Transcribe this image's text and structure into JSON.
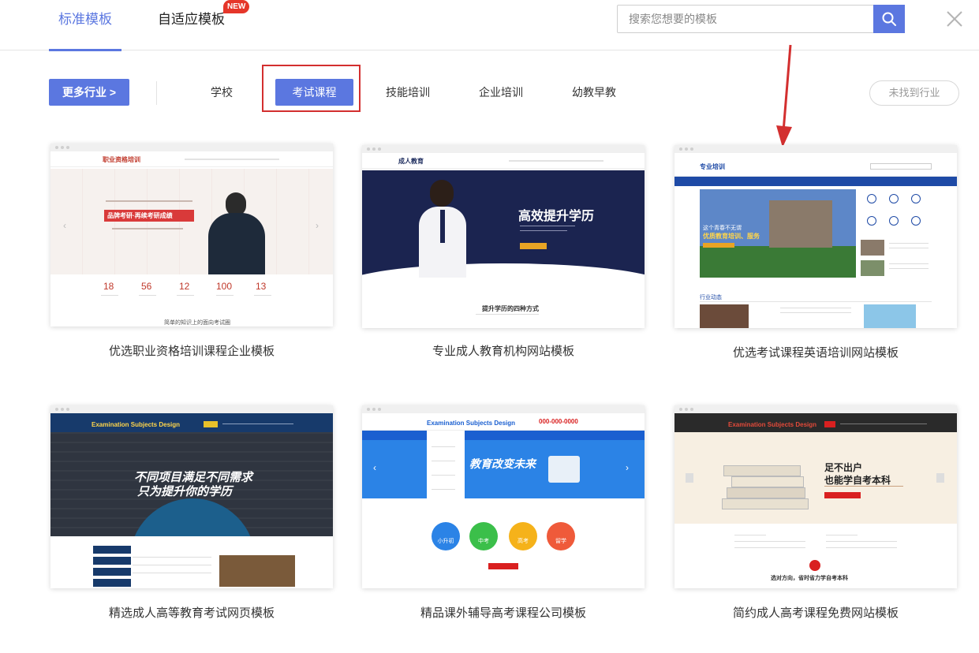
{
  "tabs": {
    "standard": "标准模板",
    "adaptive": "自适应模板",
    "new_badge": "NEW"
  },
  "search": {
    "placeholder": "搜索您想要的模板"
  },
  "filters": {
    "more_label": "更多行业 >",
    "categories": [
      "学校",
      "考试课程",
      "技能培训",
      "企业培训",
      "幼教早教"
    ],
    "active": "考试课程",
    "not_found_label": "未找到行业"
  },
  "colors": {
    "accent": "#5b77e0",
    "highlight_frame": "#d32f2f",
    "badge": "#e5362a"
  },
  "templates": [
    {
      "title": "优选职业资格培训课程企业模板",
      "preview": {
        "logo": "职业资格培训",
        "slogan": "品牌考研·再续考研成绩",
        "stats": [
          "18",
          "56",
          "12",
          "100",
          "13"
        ],
        "footer_text": "简单的知识上的面向考试圈"
      }
    },
    {
      "title": "专业成人教育机构网站模板",
      "preview": {
        "logo": "成人教育",
        "headline": "高效提升学历",
        "section_title": "提升学历的四种方式"
      }
    },
    {
      "title": "优选考试课程英语培训网站模板",
      "preview": {
        "logo": "专业培训",
        "banner_line1": "这个青春不无谓",
        "banner_line2": "优质教育培训、服务",
        "section_title": "行业动态"
      }
    },
    {
      "title": "精选成人高等教育考试网页模板",
      "preview": {
        "logo": "Examination Subjects Design",
        "line1": "不同项目满足不同需求",
        "line2": "只为提升你的学历"
      }
    },
    {
      "title": "精品课外辅导高考课程公司模板",
      "preview": {
        "logo": "Examination Subjects Design",
        "phone": "000-000-0000",
        "headline": "教育改变未来",
        "circles": [
          "小升初",
          "中考",
          "高考",
          "留学"
        ]
      }
    },
    {
      "title": "简约成人高考课程免费网站模板",
      "preview": {
        "logo": "Examination Subjects Design",
        "line1": "足不出户",
        "line2": "也能学自考本科",
        "footer_text": "选对方向，省时省力学自考本科"
      }
    }
  ]
}
